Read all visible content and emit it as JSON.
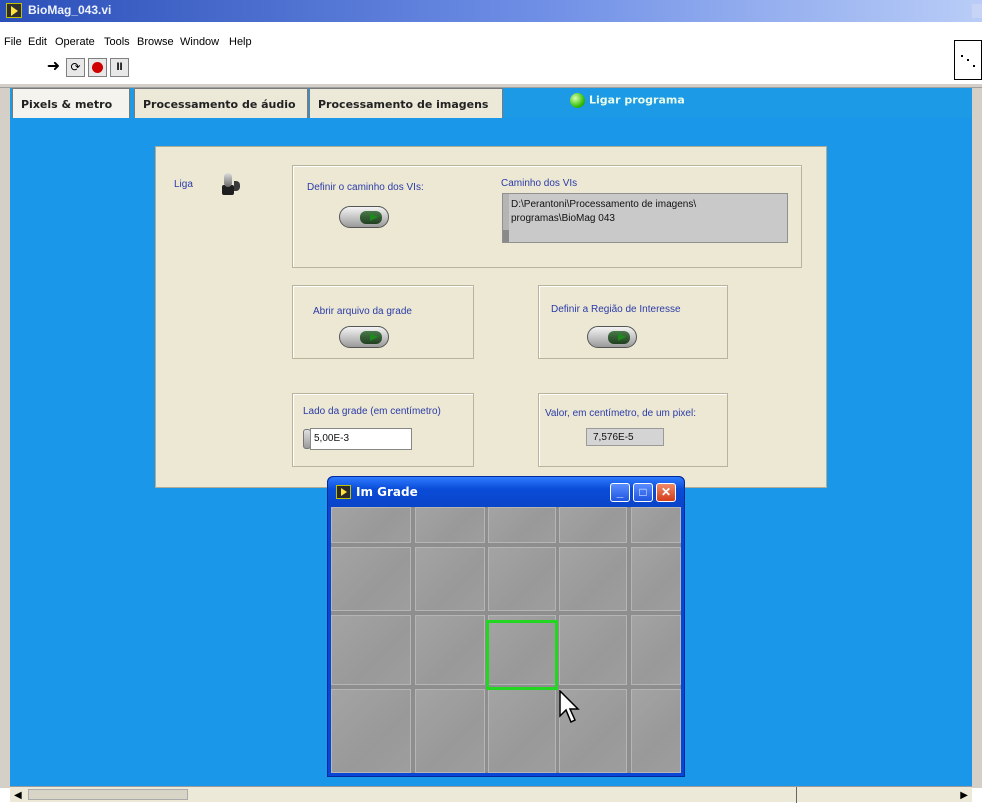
{
  "window": {
    "title": "BioMag_043.vi"
  },
  "menu": [
    {
      "label": "File"
    },
    {
      "label": "Edit"
    },
    {
      "label": "Operate"
    },
    {
      "label": "Tools"
    },
    {
      "label": "Browse"
    },
    {
      "label": "Window"
    },
    {
      "label": "Help"
    }
  ],
  "toolbar": {
    "run_icon": "run-arrow-icon",
    "run_cont_icon": "run-continuously-icon",
    "abort_icon": "abort-icon",
    "pause_icon": "pause-icon",
    "cont_glyph": "⟳",
    "pause_glyph": "II",
    "run_glyph": "➜"
  },
  "tabs": [
    {
      "label": "Pixels & metro",
      "active": true
    },
    {
      "label": "Processamento de áudio",
      "active": false
    },
    {
      "label": "Processamento de imagens",
      "active": false
    }
  ],
  "ligar": {
    "label": "Ligar programa",
    "led_color": "#38c20c"
  },
  "panel": {
    "liga_label": "Liga",
    "definir_caminho_label": "Definir o caminho dos VIs:",
    "caminho_title": "Caminho dos VIs",
    "caminho_line1": "D:\\Perantoni\\Processamento de imagens\\",
    "caminho_line2": "programas\\BioMag 043",
    "abrir_label": "Abrir arquivo da grade",
    "regiao_label": "Definir a Região de Interesse",
    "lado_label": "Lado da grade (em centímetro)",
    "lado_value": "5,00E-3",
    "valor_label": "Valor, em centímetro, de um pixel:",
    "valor_value": "7,576E-5"
  },
  "image_window": {
    "title": "Im Grade",
    "minimize": "_",
    "maximize": "□",
    "close": "✕",
    "roi_color": "#22d622"
  },
  "colors": {
    "background_blue": "#1a97e8",
    "panel": "#ece8d4",
    "label_blue": "#2b3ba8"
  }
}
